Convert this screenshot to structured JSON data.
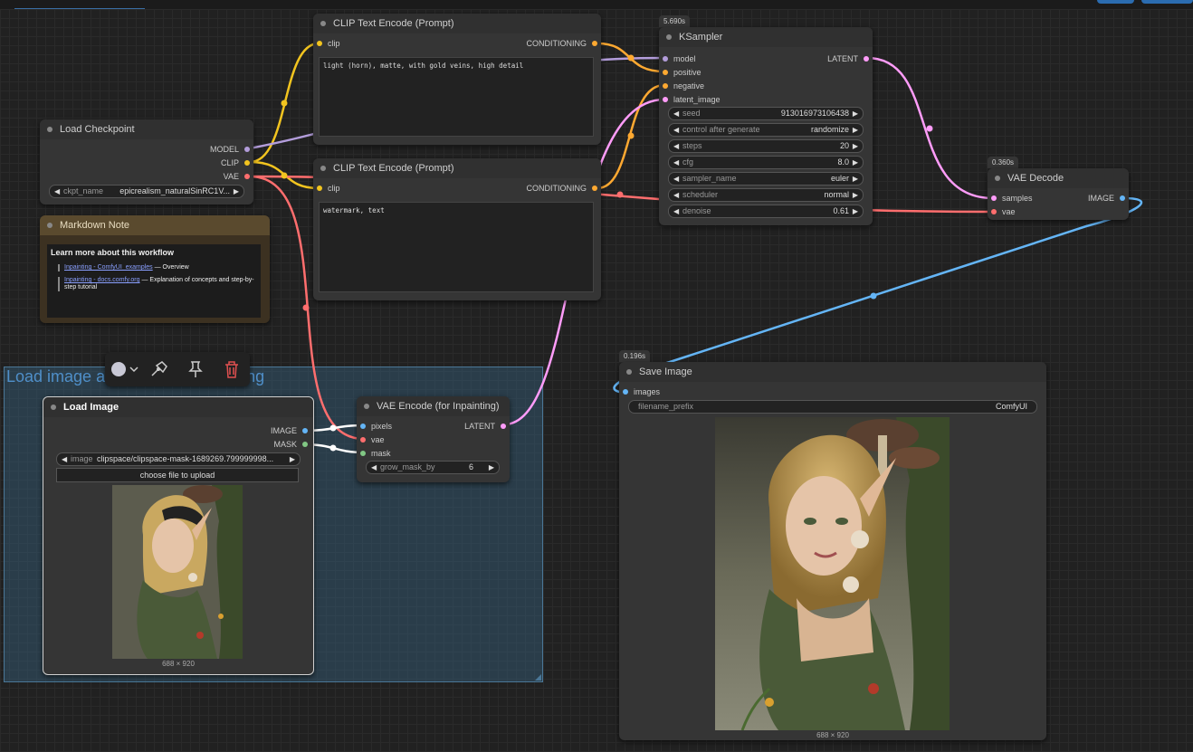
{
  "nodes": {
    "clip_top": {
      "title": "CLIP Text Encode (Prompt)",
      "input_clip": "clip",
      "output": "CONDITIONING",
      "text": "light (horn), matte, with gold veins, high detail"
    },
    "clip_bottom": {
      "title": "CLIP Text Encode (Prompt)",
      "input_clip": "clip",
      "output": "CONDITIONING",
      "text": "watermark, text"
    },
    "checkpoint": {
      "title": "Load Checkpoint",
      "out_model": "MODEL",
      "out_clip": "CLIP",
      "out_vae": "VAE",
      "ckpt_label": "ckpt_name",
      "ckpt_value": "epicrealism_naturalSinRC1V..."
    },
    "note": {
      "title": "Markdown Note",
      "heading": "Learn more about this workflow",
      "link1": "Inpainting - ComfyUI_examples",
      "link1_suffix": " — Overview",
      "link2": "Inpainting - docs.comfy.org",
      "link2_suffix": " — Explanation of concepts and step-by-step tutorial"
    },
    "ksampler": {
      "badge": "5.690s",
      "title": "KSampler",
      "in_model": "model",
      "in_positive": "positive",
      "in_negative": "negative",
      "in_latent": "latent_image",
      "output": "LATENT",
      "widgets": [
        {
          "label": "seed",
          "value": "913016973106438"
        },
        {
          "label": "control after generate",
          "value": "randomize"
        },
        {
          "label": "steps",
          "value": "20"
        },
        {
          "label": "cfg",
          "value": "8.0"
        },
        {
          "label": "sampler_name",
          "value": "euler"
        },
        {
          "label": "scheduler",
          "value": "normal"
        },
        {
          "label": "denoise",
          "value": "0.61"
        }
      ]
    },
    "vae_decode": {
      "badge": "0.360s",
      "title": "VAE Decode",
      "in_samples": "samples",
      "in_vae": "vae",
      "output": "IMAGE"
    },
    "save_image": {
      "badge": "0.196s",
      "title": "Save Image",
      "in_images": "images",
      "prefix_label": "filename_prefix",
      "prefix_value": "ComfyUI",
      "caption": "688 × 920"
    },
    "load_image": {
      "title": "Load Image",
      "out_image": "IMAGE",
      "out_mask": "MASK",
      "image_label": "image",
      "image_value": "clipspace/clipspace-mask-1689269.799999998...",
      "upload_label": "choose file to upload",
      "caption": "688 × 920"
    },
    "vae_encode": {
      "title": "VAE Encode (for Inpainting)",
      "in_pixels": "pixels",
      "in_vae": "vae",
      "in_mask": "mask",
      "output": "LATENT",
      "grow_label": "grow_mask_by",
      "grow_value": "6"
    }
  },
  "group": {
    "title": "Load image and mask for inpainting"
  },
  "toolbar": {
    "items": [
      "color-picker-icon",
      "chevron-down-icon",
      "bypass-icon",
      "pin-icon",
      "delete-icon"
    ]
  },
  "colors": {
    "clip": "#f2c41f",
    "model": "#b39ddb",
    "vae": "#ff6e6e",
    "conditioning": "#ffa931",
    "latent": "#ff9cf9",
    "image": "#64b5f6",
    "mask": "#81c784"
  }
}
